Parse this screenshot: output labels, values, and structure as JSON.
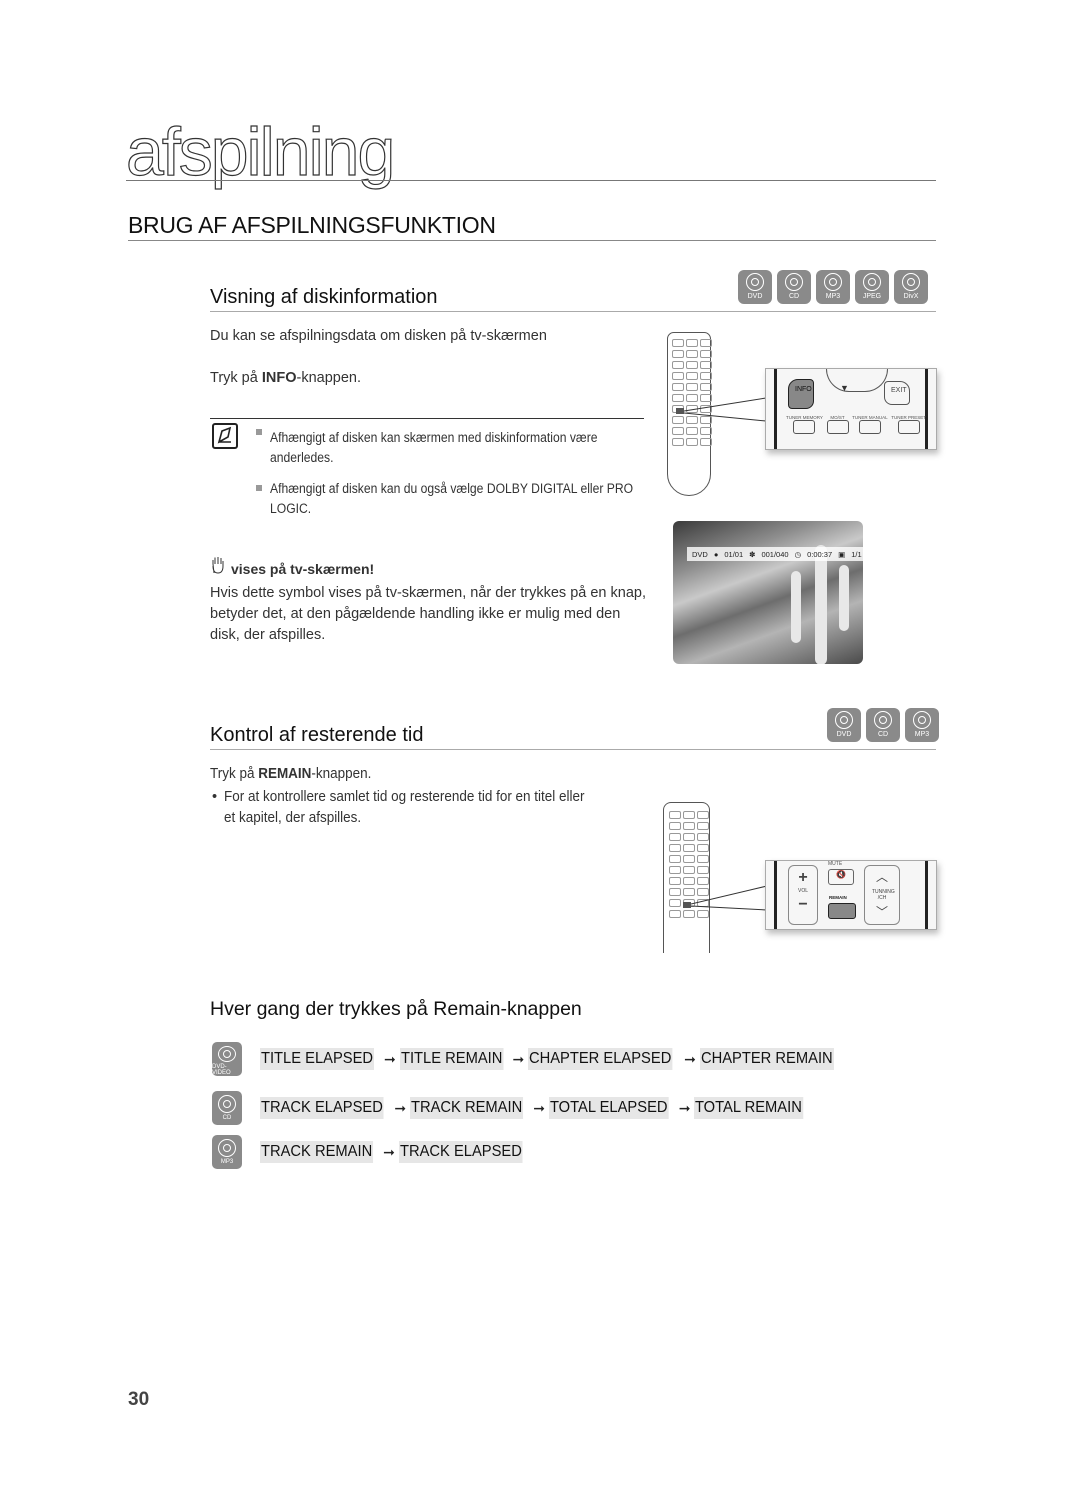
{
  "chapter": {
    "title": "afspilning"
  },
  "section": {
    "title": "BRUG AF AFSPILNINGSFUNKTION"
  },
  "disc_info": {
    "title": "Visning af diskinformation",
    "disc_types": [
      "DVD",
      "CD",
      "MP3",
      "JPEG",
      "DivX"
    ],
    "intro": "Du kan se afspilningsdata om disken på tv-skærmen",
    "instruction_prefix": "Tryk på ",
    "instruction_button": "INFO",
    "instruction_suffix": "-knappen.",
    "notes": [
      "Afhængigt af disken kan skærmen med diskinformation være anderledes.",
      "Afhængigt af disken kan du også vælge DOLBY DIGITAL eller PRO LOGIC."
    ],
    "hand_heading": "vises på tv-skærmen!",
    "hand_text": "Hvis dette symbol vises på tv-skærmen, når der trykkes på en knap, betyder det, at den pågældende handling ikke er mulig med den disk, der afspilles.",
    "remote_zoom": {
      "info_label": "INFO",
      "exit_label": "EXIT",
      "buttons": [
        "TUNER MEMORY",
        "MO/ST",
        "TUNER MANUAL",
        "TUNER PRESET"
      ]
    },
    "osd": {
      "disc": "DVD",
      "title": "01/01",
      "chapter": "001/040",
      "time": "0:00:37",
      "angle": "1/1",
      "play": "▶"
    }
  },
  "remaining_time": {
    "title": "Kontrol af resterende tid",
    "disc_types": [
      "DVD",
      "CD",
      "MP3"
    ],
    "instruction_prefix": "Tryk på ",
    "instruction_button": "REMAIN",
    "instruction_suffix": "-knappen.",
    "bullet": "For at kontrollere samlet tid og resterende tid for en titel eller et kapitel, der afspilles.",
    "remote_zoom": {
      "mute_label": "MUTE",
      "vol_label": "VOL",
      "remain_label": "REMAIN",
      "tuning_label": "TUNNING /CH"
    }
  },
  "remain_sequence": {
    "title": "Hver gang der trykkes på Remain-knappen",
    "arrow": "➞",
    "rows": [
      {
        "disc": "DVD-VIDEO",
        "items": [
          "TITLE ELAPSED",
          "TITLE REMAIN",
          "CHAPTER ELAPSED",
          "CHAPTER REMAIN"
        ]
      },
      {
        "disc": "CD",
        "items": [
          "TRACK ELAPSED",
          "TRACK REMAIN",
          "TOTAL ELAPSED",
          "TOTAL REMAIN"
        ]
      },
      {
        "disc": "MP3",
        "items": [
          "TRACK REMAIN",
          "TRACK ELAPSED"
        ]
      }
    ]
  },
  "page_number": "30"
}
